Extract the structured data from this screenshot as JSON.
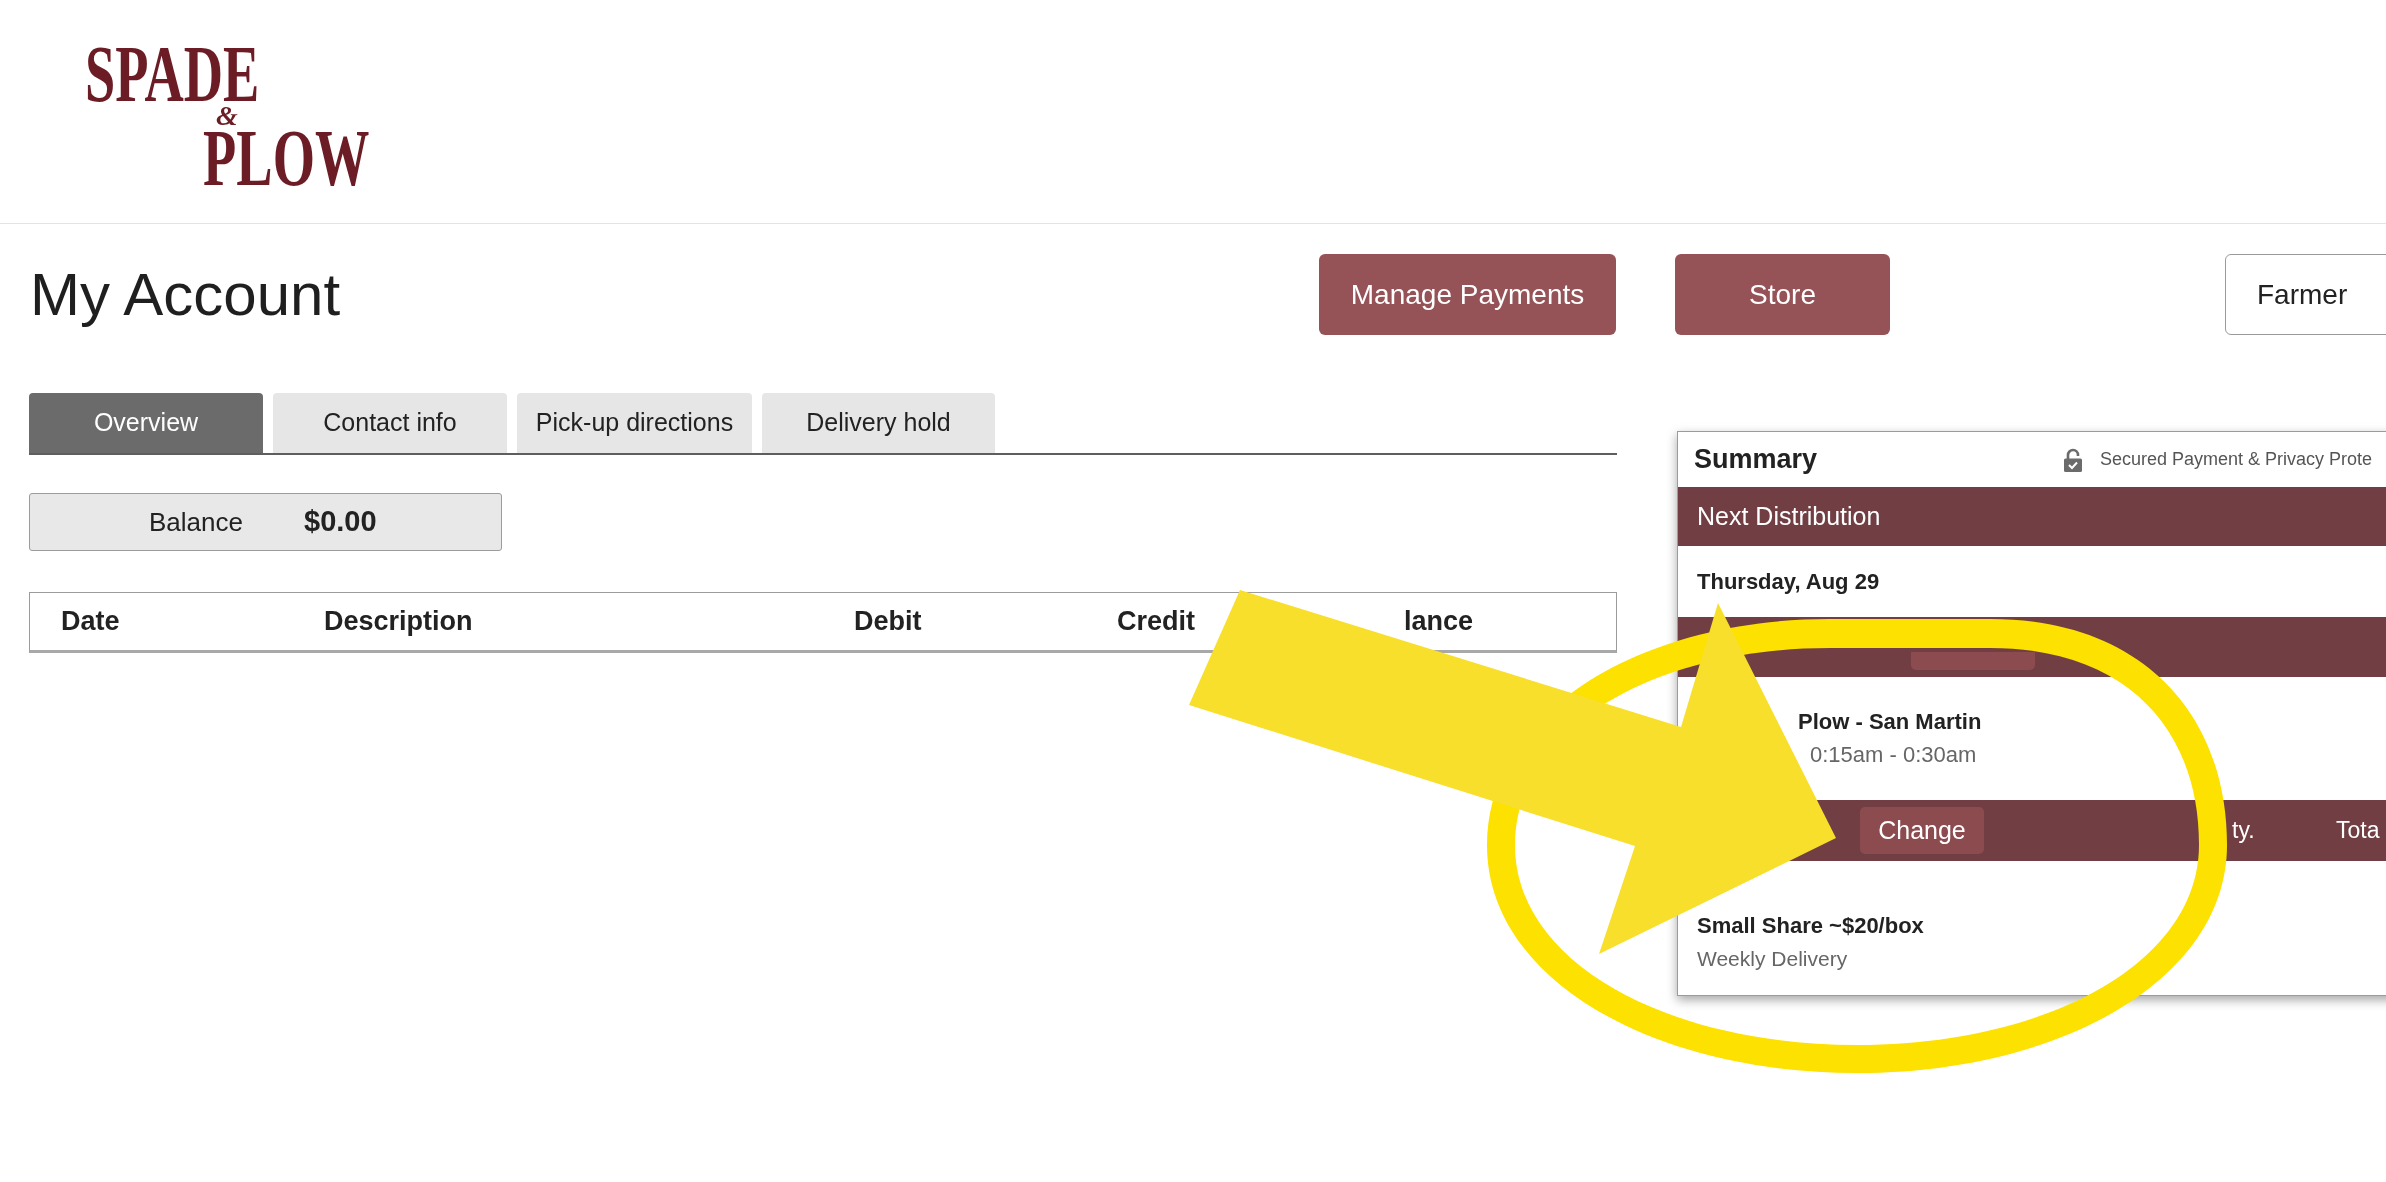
{
  "logo": {
    "top_word": "SPADE",
    "ampersand": "&",
    "bottom_word": "PLOW"
  },
  "page": {
    "title": "My Account",
    "buttons": [
      "Manage Payments",
      "Store"
    ],
    "role_select": {
      "value": "Farmer"
    }
  },
  "tabs": [
    {
      "label": "Overview",
      "selected": true
    },
    {
      "label": "Contact info",
      "selected": false
    },
    {
      "label": "Pick-up directions",
      "selected": false
    },
    {
      "label": "Delivery hold",
      "selected": false
    }
  ],
  "balance": {
    "label": "Balance",
    "value": "$0.00"
  },
  "ledger": {
    "columns": [
      "Date",
      "Description",
      "Debit",
      "Credit",
      "lance"
    ]
  },
  "summary": {
    "title": "Summary",
    "security_note": "Secured Payment & Privacy Prote",
    "next_distribution": {
      "heading": "Next Distribution",
      "date": "Thursday, Aug 29"
    },
    "pickup": {
      "location": "Plow - San Martin",
      "time": "0:15am - 0:30am"
    },
    "items": {
      "change_button": "Change",
      "columns": [
        "ty.",
        "Tota"
      ],
      "rows": [
        {
          "name": "Small Share ~$20/box",
          "frequency": "Weekly Delivery"
        }
      ]
    }
  },
  "annotations": [
    {
      "kind": "ellipse"
    },
    {
      "kind": "arrow"
    }
  ]
}
